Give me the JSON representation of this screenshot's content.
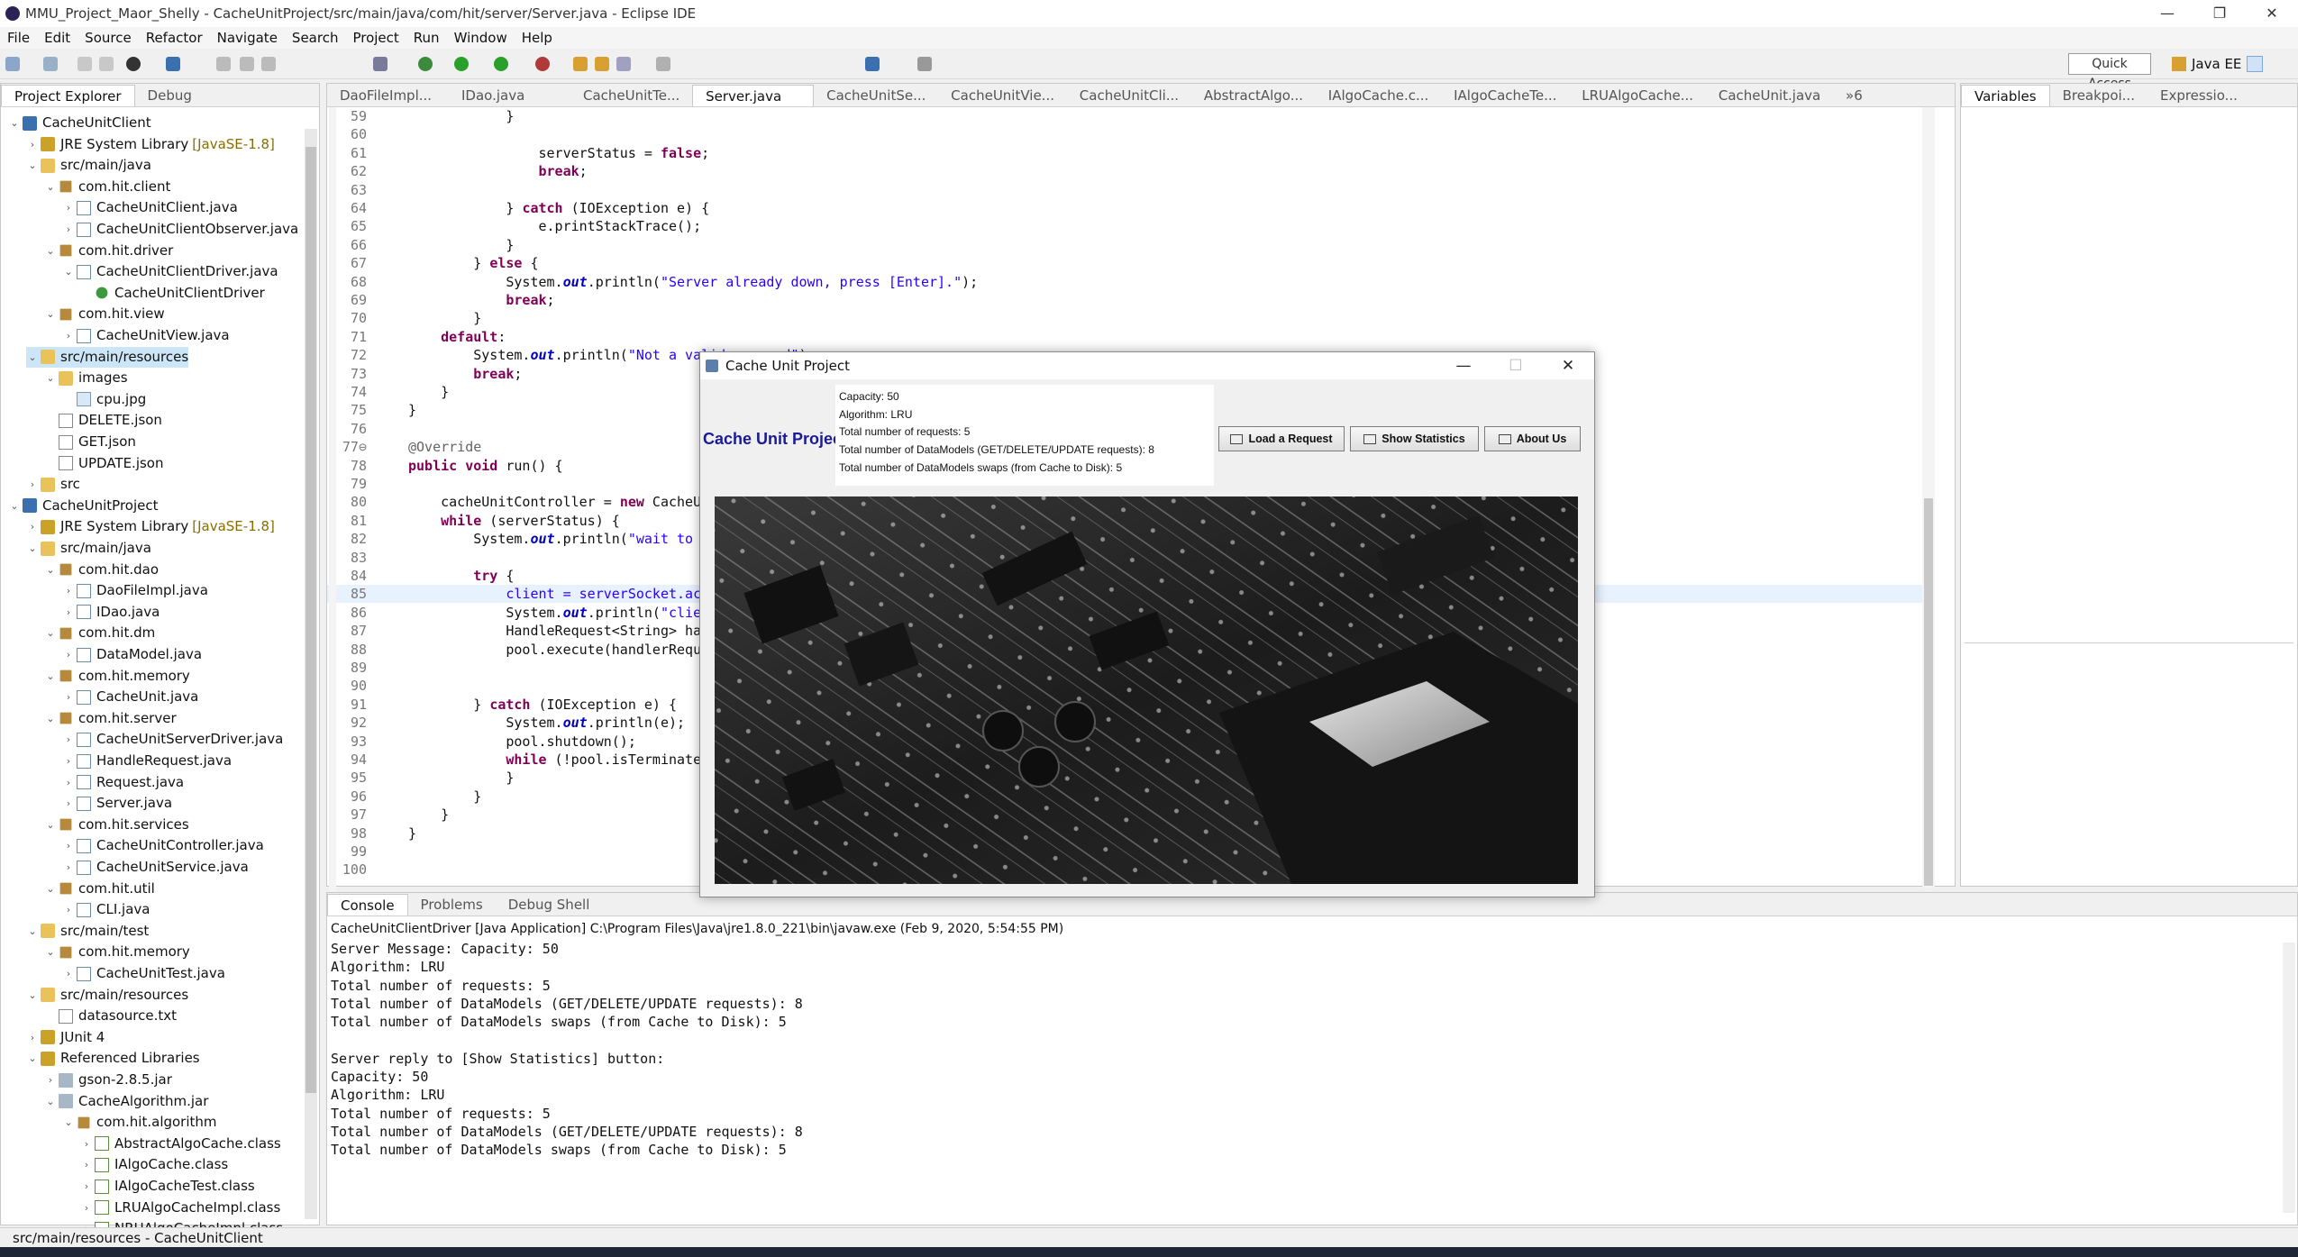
{
  "window": {
    "title": "MMU_Project_Maor_Shelly - CacheUnitProject/src/main/java/com/hit/server/Server.java - Eclipse IDE",
    "controls": [
      "—",
      "❐",
      "✕"
    ]
  },
  "menu": [
    "File",
    "Edit",
    "Source",
    "Refactor",
    "Navigate",
    "Search",
    "Project",
    "Run",
    "Window",
    "Help"
  ],
  "quick_access": "Quick Access",
  "perspective": "Java EE",
  "explorer": {
    "tabs": [
      "Project Explorer",
      "Debug"
    ],
    "rows": [
      {
        "d": 0,
        "tw": "v",
        "ic": "project",
        "label": "CacheUnitClient"
      },
      {
        "d": 1,
        "tw": ">",
        "ic": "lib",
        "label": "JRE System Library",
        "ver": "[JavaSE-1.8]"
      },
      {
        "d": 1,
        "tw": "v",
        "ic": "folder",
        "label": "src/main/java"
      },
      {
        "d": 2,
        "tw": "v",
        "ic": "pkg",
        "label": "com.hit.client"
      },
      {
        "d": 3,
        "tw": ">",
        "ic": "java",
        "label": "CacheUnitClient.java"
      },
      {
        "d": 3,
        "tw": ">",
        "ic": "java",
        "label": "CacheUnitClientObserver.java"
      },
      {
        "d": 2,
        "tw": "v",
        "ic": "pkg",
        "label": "com.hit.driver"
      },
      {
        "d": 3,
        "tw": "v",
        "ic": "java",
        "label": "CacheUnitClientDriver.java"
      },
      {
        "d": 4,
        "tw": "",
        "ic": "main",
        "label": "CacheUnitClientDriver"
      },
      {
        "d": 2,
        "tw": "v",
        "ic": "pkg",
        "label": "com.hit.view"
      },
      {
        "d": 3,
        "tw": ">",
        "ic": "java",
        "label": "CacheUnitView.java"
      },
      {
        "d": 1,
        "tw": "v",
        "ic": "folder",
        "label": "src/main/resources",
        "sel": true
      },
      {
        "d": 2,
        "tw": "v",
        "ic": "folder",
        "label": "images"
      },
      {
        "d": 3,
        "tw": "",
        "ic": "img",
        "label": "cpu.jpg"
      },
      {
        "d": 2,
        "tw": "",
        "ic": "file",
        "label": "DELETE.json"
      },
      {
        "d": 2,
        "tw": "",
        "ic": "file",
        "label": "GET.json"
      },
      {
        "d": 2,
        "tw": "",
        "ic": "file",
        "label": "UPDATE.json"
      },
      {
        "d": 1,
        "tw": ">",
        "ic": "folder",
        "label": "src"
      },
      {
        "d": 0,
        "tw": "v",
        "ic": "project",
        "label": "CacheUnitProject"
      },
      {
        "d": 1,
        "tw": ">",
        "ic": "lib",
        "label": "JRE System Library",
        "ver": "[JavaSE-1.8]"
      },
      {
        "d": 1,
        "tw": "v",
        "ic": "folder",
        "label": "src/main/java"
      },
      {
        "d": 2,
        "tw": "v",
        "ic": "pkg",
        "label": "com.hit.dao"
      },
      {
        "d": 3,
        "tw": ">",
        "ic": "java",
        "label": "DaoFileImpl.java"
      },
      {
        "d": 3,
        "tw": ">",
        "ic": "java",
        "label": "IDao.java"
      },
      {
        "d": 2,
        "tw": "v",
        "ic": "pkg",
        "label": "com.hit.dm"
      },
      {
        "d": 3,
        "tw": ">",
        "ic": "java",
        "label": "DataModel.java"
      },
      {
        "d": 2,
        "tw": "v",
        "ic": "pkg",
        "label": "com.hit.memory"
      },
      {
        "d": 3,
        "tw": ">",
        "ic": "java",
        "label": "CacheUnit.java"
      },
      {
        "d": 2,
        "tw": "v",
        "ic": "pkg",
        "label": "com.hit.server"
      },
      {
        "d": 3,
        "tw": ">",
        "ic": "java",
        "label": "CacheUnitServerDriver.java"
      },
      {
        "d": 3,
        "tw": ">",
        "ic": "java",
        "label": "HandleRequest.java"
      },
      {
        "d": 3,
        "tw": ">",
        "ic": "java",
        "label": "Request.java"
      },
      {
        "d": 3,
        "tw": ">",
        "ic": "java",
        "label": "Server.java"
      },
      {
        "d": 2,
        "tw": "v",
        "ic": "pkg",
        "label": "com.hit.services"
      },
      {
        "d": 3,
        "tw": ">",
        "ic": "java",
        "label": "CacheUnitController.java"
      },
      {
        "d": 3,
        "tw": ">",
        "ic": "java",
        "label": "CacheUnitService.java"
      },
      {
        "d": 2,
        "tw": "v",
        "ic": "pkg",
        "label": "com.hit.util"
      },
      {
        "d": 3,
        "tw": ">",
        "ic": "java",
        "label": "CLI.java"
      },
      {
        "d": 1,
        "tw": "v",
        "ic": "folder",
        "label": "src/main/test"
      },
      {
        "d": 2,
        "tw": "v",
        "ic": "pkg",
        "label": "com.hit.memory"
      },
      {
        "d": 3,
        "tw": ">",
        "ic": "java",
        "label": "CacheUnitTest.java"
      },
      {
        "d": 1,
        "tw": "v",
        "ic": "folder",
        "label": "src/main/resources"
      },
      {
        "d": 2,
        "tw": "",
        "ic": "file",
        "label": "datasource.txt"
      },
      {
        "d": 1,
        "tw": ">",
        "ic": "lib",
        "label": "JUnit 4"
      },
      {
        "d": 1,
        "tw": "v",
        "ic": "lib",
        "label": "Referenced Libraries"
      },
      {
        "d": 2,
        "tw": ">",
        "ic": "jar",
        "label": "gson-2.8.5.jar"
      },
      {
        "d": 2,
        "tw": "v",
        "ic": "jar",
        "label": "CacheAlgorithm.jar"
      },
      {
        "d": 3,
        "tw": "v",
        "ic": "pkg",
        "label": "com.hit.algorithm"
      },
      {
        "d": 4,
        "tw": ">",
        "ic": "class",
        "label": "AbstractAlgoCache.class"
      },
      {
        "d": 4,
        "tw": ">",
        "ic": "class",
        "label": "IAlgoCache.class"
      },
      {
        "d": 4,
        "tw": ">",
        "ic": "class",
        "label": "IAlgoCacheTest.class"
      },
      {
        "d": 4,
        "tw": ">",
        "ic": "class",
        "label": "LRUAlgoCacheImpl.class"
      },
      {
        "d": 4,
        "tw": ">",
        "ic": "class",
        "label": "NRUAlgoCacheImpl.class"
      }
    ]
  },
  "editor": {
    "tabs": [
      "DaoFileImpl...",
      "IDao.java",
      "CacheUnitTe...",
      "Server.java",
      "CacheUnitSe...",
      "CacheUnitVie...",
      "CacheUnitCli...",
      "AbstractAlgo...",
      "IAlgoCache.c...",
      "IAlgoCacheTe...",
      "LRUAlgoCache...",
      "CacheUnit.java",
      "»6"
    ],
    "active_tab": 3,
    "lines": [
      {
        "n": "59",
        "segs": [
          [
            "            }",
            ""
          ]
        ]
      },
      {
        "n": "60",
        "segs": [
          [
            "",
            ""
          ]
        ]
      },
      {
        "n": "61",
        "segs": [
          [
            "                serverStatus = ",
            ""
          ],
          [
            "false",
            "kw"
          ],
          [
            ";",
            ""
          ]
        ]
      },
      {
        "n": "62",
        "segs": [
          [
            "                ",
            ""
          ],
          [
            "break",
            "kw"
          ],
          [
            ";",
            ""
          ]
        ]
      },
      {
        "n": "63",
        "segs": [
          [
            "",
            ""
          ]
        ]
      },
      {
        "n": "64",
        "segs": [
          [
            "            } ",
            ""
          ],
          [
            "catch",
            "kw"
          ],
          [
            " (IOException e) {",
            ""
          ]
        ]
      },
      {
        "n": "65",
        "segs": [
          [
            "                e.printStackTrace();",
            ""
          ]
        ]
      },
      {
        "n": "66",
        "segs": [
          [
            "            }",
            ""
          ]
        ]
      },
      {
        "n": "67",
        "segs": [
          [
            "        } ",
            ""
          ],
          [
            "else",
            "kw"
          ],
          [
            " {",
            ""
          ]
        ]
      },
      {
        "n": "68",
        "segs": [
          [
            "            System.",
            ""
          ],
          [
            "out",
            "fld"
          ],
          [
            ".println(",
            ""
          ],
          [
            "\"Server already down, press [Enter].\"",
            "str"
          ],
          [
            ");",
            ""
          ]
        ]
      },
      {
        "n": "69",
        "segs": [
          [
            "            ",
            ""
          ],
          [
            "break",
            "kw"
          ],
          [
            ";",
            ""
          ]
        ]
      },
      {
        "n": "70",
        "segs": [
          [
            "        }",
            ""
          ]
        ]
      },
      {
        "n": "71",
        "segs": [
          [
            "    ",
            ""
          ],
          [
            "default",
            "kw"
          ],
          [
            ":",
            ""
          ]
        ]
      },
      {
        "n": "72",
        "segs": [
          [
            "        System.",
            ""
          ],
          [
            "out",
            "fld"
          ],
          [
            ".println(",
            ""
          ],
          [
            "\"Not a valid command\"",
            "str"
          ],
          [
            ");",
            ""
          ]
        ]
      },
      {
        "n": "73",
        "segs": [
          [
            "        ",
            ""
          ],
          [
            "break",
            "kw"
          ],
          [
            ";",
            ""
          ]
        ]
      },
      {
        "n": "74",
        "segs": [
          [
            "    }",
            ""
          ]
        ]
      },
      {
        "n": "75",
        "segs": [
          [
            "}",
            ""
          ]
        ]
      },
      {
        "n": "76",
        "segs": [
          [
            "",
            ""
          ]
        ]
      },
      {
        "n": "77⊖",
        "segs": [
          [
            "@Override",
            "ann"
          ]
        ]
      },
      {
        "n": "78",
        "segs": [
          [
            "",
            ""
          ],
          [
            "public",
            "kw"
          ],
          [
            " ",
            ""
          ],
          [
            "void",
            "kw"
          ],
          [
            " run() {",
            ""
          ]
        ]
      },
      {
        "n": "79",
        "segs": [
          [
            "",
            ""
          ]
        ]
      },
      {
        "n": "80",
        "segs": [
          [
            "    cacheUnitController = ",
            ""
          ],
          [
            "new",
            "kw"
          ],
          [
            " CacheU",
            ""
          ]
        ]
      },
      {
        "n": "81",
        "segs": [
          [
            "    ",
            ""
          ],
          [
            "while",
            "kw"
          ],
          [
            " (serverStatus) {",
            ""
          ]
        ]
      },
      {
        "n": "82",
        "segs": [
          [
            "        System.",
            ""
          ],
          [
            "out",
            "fld"
          ],
          [
            ".println(",
            ""
          ],
          [
            "\"wait to",
            "str"
          ]
        ]
      },
      {
        "n": "83",
        "segs": [
          [
            "",
            ""
          ]
        ]
      },
      {
        "n": "84",
        "segs": [
          [
            "        ",
            ""
          ],
          [
            "try",
            "kw"
          ],
          [
            " {",
            ""
          ]
        ]
      },
      {
        "n": "85",
        "segs": [
          [
            "            client = serverSocket.ac",
            "str"
          ]
        ],
        "hl": true
      },
      {
        "n": "86",
        "segs": [
          [
            "            System.",
            ""
          ],
          [
            "out",
            "fld"
          ],
          [
            ".println(",
            ""
          ],
          [
            "\"clie",
            "str"
          ]
        ]
      },
      {
        "n": "87",
        "segs": [
          [
            "            HandleRequest<String> ha",
            ""
          ]
        ]
      },
      {
        "n": "88",
        "segs": [
          [
            "            pool.execute(handlerRequ",
            ""
          ]
        ]
      },
      {
        "n": "89",
        "segs": [
          [
            "",
            ""
          ]
        ]
      },
      {
        "n": "90",
        "segs": [
          [
            "",
            ""
          ]
        ]
      },
      {
        "n": "91",
        "segs": [
          [
            "        } ",
            ""
          ],
          [
            "catch",
            "kw"
          ],
          [
            " (IOException e) {",
            ""
          ]
        ]
      },
      {
        "n": "92",
        "segs": [
          [
            "            System.",
            ""
          ],
          [
            "out",
            "fld"
          ],
          [
            ".println(e);",
            ""
          ]
        ]
      },
      {
        "n": "93",
        "segs": [
          [
            "            pool.shutdown();",
            ""
          ]
        ]
      },
      {
        "n": "94",
        "segs": [
          [
            "            ",
            ""
          ],
          [
            "while",
            "kw"
          ],
          [
            " (!pool.isTerminate",
            ""
          ]
        ]
      },
      {
        "n": "95",
        "segs": [
          [
            "            }",
            ""
          ]
        ]
      },
      {
        "n": "96",
        "segs": [
          [
            "        }",
            ""
          ]
        ]
      },
      {
        "n": "97",
        "segs": [
          [
            "    }",
            ""
          ]
        ]
      },
      {
        "n": "98",
        "segs": [
          [
            "}",
            ""
          ]
        ]
      },
      {
        "n": "99",
        "segs": [
          [
            "",
            ""
          ]
        ]
      },
      {
        "n": "100",
        "segs": [
          [
            "",
            ""
          ]
        ]
      }
    ]
  },
  "variables": {
    "tabs": [
      "Variables",
      "Breakpoi...",
      "Expressio..."
    ]
  },
  "console": {
    "tabs": [
      "Console",
      "Problems",
      "Debug Shell"
    ],
    "header": "CacheUnitClientDriver [Java Application] C:\\Program Files\\Java\\jre1.8.0_221\\bin\\javaw.exe (Feb 9, 2020, 5:54:55 PM)",
    "lines": [
      "Server Message: Capacity: 50",
      "Algorithm: LRU",
      "Total number of requests: 5",
      "Total number of DataModels (GET/DELETE/UPDATE requests): 8",
      "Total number of DataModels swaps (from Cache to Disk): 5",
      "",
      "Server reply to [Show Statistics] button:",
      "Capacity: 50",
      "Algorithm: LRU",
      "Total number of requests: 5",
      "Total number of DataModels (GET/DELETE/UPDATE requests): 8",
      "Total number of DataModels swaps (from Cache to Disk): 5"
    ]
  },
  "status": "src/main/resources - CacheUnitClient",
  "dialog": {
    "title": "Cache Unit Project",
    "heading": "Cache Unit Project",
    "stats": [
      "Capacity: 50",
      "Algorithm: LRU",
      "Total number of requests: 5",
      "Total number of DataModels (GET/DELETE/UPDATE requests): 8",
      "Total number of DataModels swaps (from Cache to Disk): 5"
    ],
    "buttons": {
      "load": "Load a Request",
      "stats": "Show Statistics",
      "about": "About Us"
    },
    "controls": [
      "—",
      "☐",
      "✕"
    ]
  }
}
